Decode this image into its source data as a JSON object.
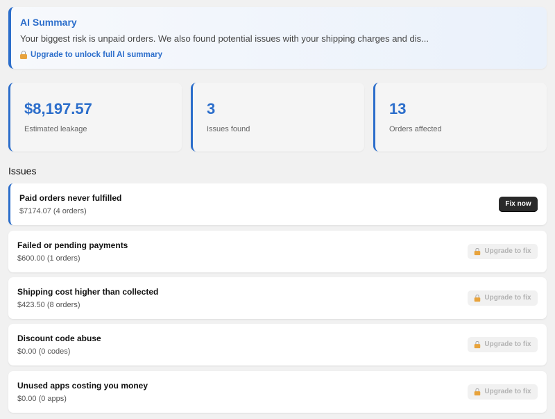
{
  "ai_summary": {
    "title": "AI Summary",
    "text": "Your biggest risk is unpaid orders. We also found potential issues with your shipping charges and dis...",
    "upgrade_link": "Upgrade to unlock full AI summary"
  },
  "stats": [
    {
      "value": "$8,197.57",
      "label": "Estimated leakage"
    },
    {
      "value": "3",
      "label": "Issues found"
    },
    {
      "value": "13",
      "label": "Orders affected"
    }
  ],
  "issues_heading": "Issues",
  "issues": [
    {
      "title": "Paid orders never fulfilled",
      "subtitle": "$7174.07 (4 orders)",
      "action": "Fix now"
    },
    {
      "title": "Failed or pending payments",
      "subtitle": "$600.00 (1 orders)",
      "action": "Upgrade to fix"
    },
    {
      "title": "Shipping cost higher than collected",
      "subtitle": "$423.50 (8 orders)",
      "action": "Upgrade to fix"
    },
    {
      "title": "Discount code abuse",
      "subtitle": "$0.00 (0 codes)",
      "action": "Upgrade to fix"
    },
    {
      "title": "Unused apps costing you money",
      "subtitle": "$0.00 (0 apps)",
      "action": "Upgrade to fix"
    }
  ],
  "colors": {
    "accent": "#2c6ecb",
    "fix_button": "#2a2a2a",
    "lock": "#e8a33c"
  }
}
